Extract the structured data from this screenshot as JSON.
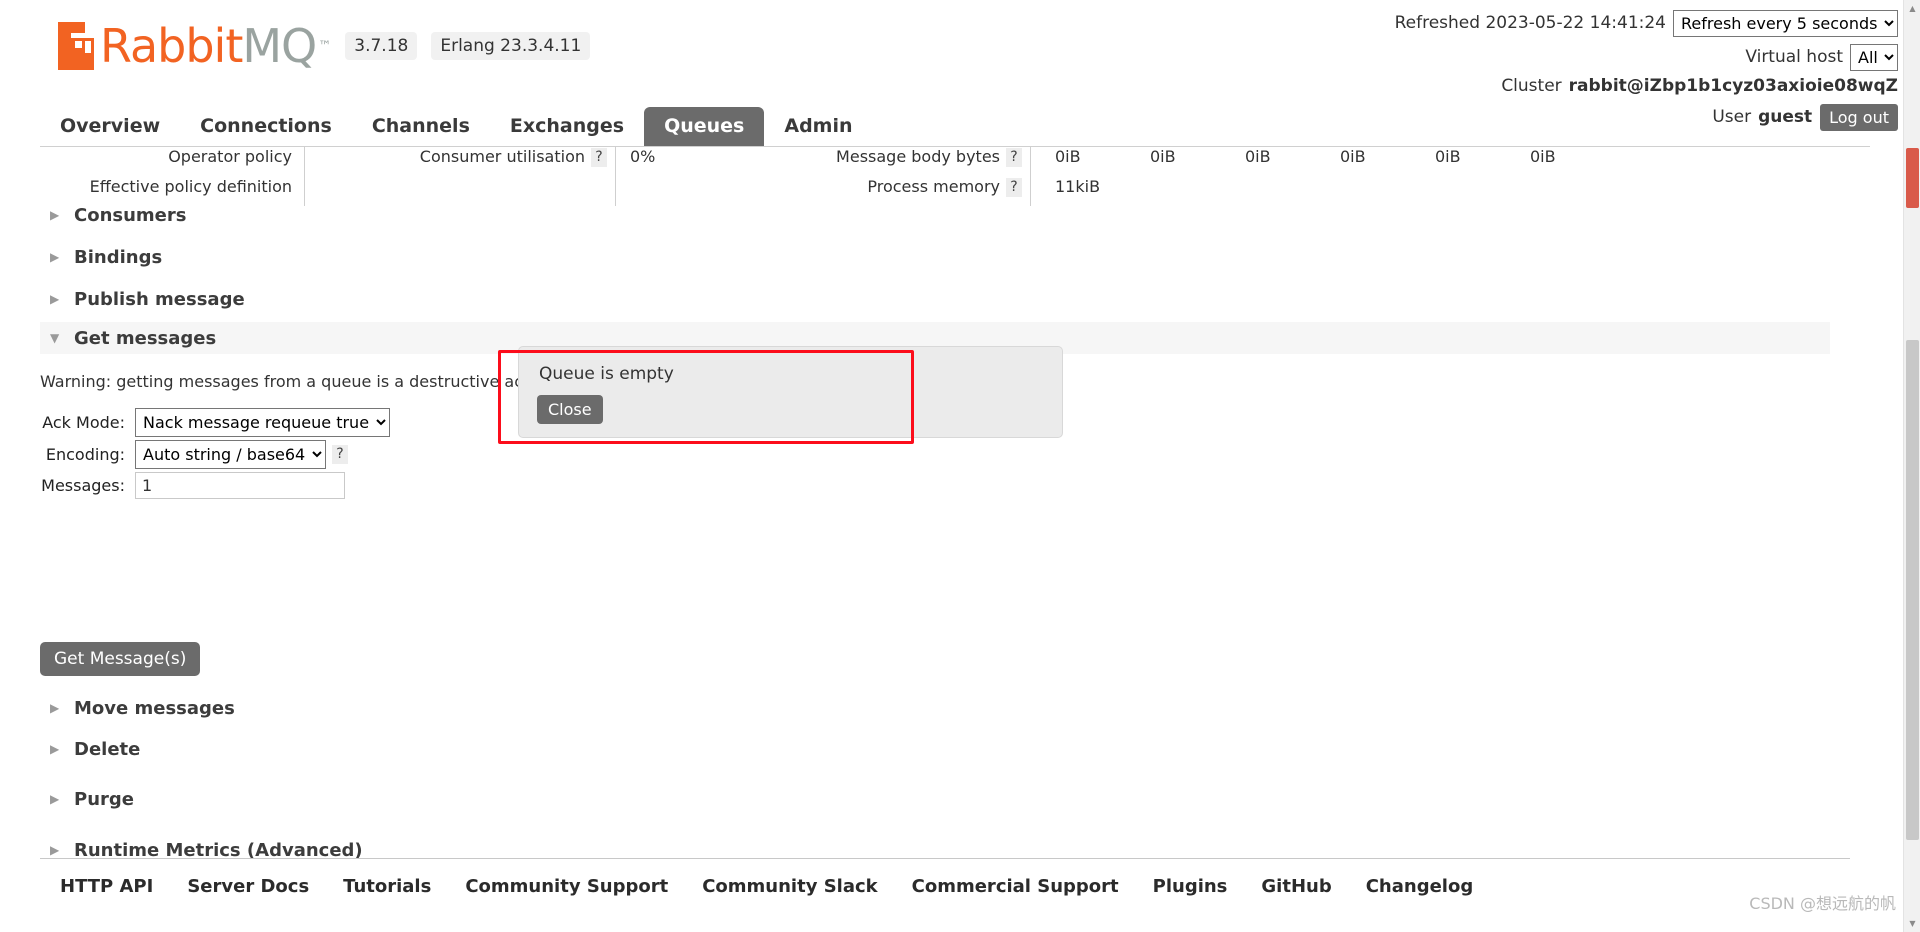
{
  "brand": {
    "name_rabbit": "Rabbit",
    "name_mq": "MQ",
    "tm": "™",
    "version": "3.7.18",
    "erlang": "Erlang 23.3.4.11",
    "accent_color": "#f26322",
    "mq_color": "#9aa3a0"
  },
  "header": {
    "refreshed_label": "Refreshed 2023-05-22 14:41:24",
    "refresh_select_value": "Refresh every 5 seconds",
    "refresh_options": [
      "Refresh every 5 seconds"
    ],
    "vhost_label": "Virtual host",
    "vhost_select_value": "All",
    "vhost_options": [
      "All"
    ],
    "cluster_label": "Cluster",
    "cluster_name": "rabbit@iZbp1b1cyz03axioie08wqZ",
    "user_label": "User",
    "user_name": "guest",
    "logout_label": "Log out"
  },
  "tabs": [
    {
      "label": "Overview",
      "active": false
    },
    {
      "label": "Connections",
      "active": false
    },
    {
      "label": "Channels",
      "active": false
    },
    {
      "label": "Exchanges",
      "active": false
    },
    {
      "label": "Queues",
      "active": true
    },
    {
      "label": "Admin",
      "active": false
    }
  ],
  "stats": {
    "row1": {
      "policy_label": "Operator policy",
      "policy_value": "",
      "consumer_util_label": "Consumer utilisation",
      "consumer_util_help": "?",
      "consumer_util_value": "0%",
      "body_bytes_label": "Message body bytes",
      "body_bytes_help": "?",
      "body_bytes_values": [
        "0iB",
        "0iB",
        "0iB",
        "0iB",
        "0iB",
        "0iB"
      ]
    },
    "row2": {
      "effective_policy_label": "Effective policy definition",
      "process_memory_label": "Process memory",
      "process_memory_help": "?",
      "process_memory_value": "11kiB"
    }
  },
  "popup": {
    "message": "Queue is empty",
    "close_label": "Close",
    "highlight_color": "#fc0d1b"
  },
  "sections": [
    {
      "label": "Consumers",
      "open": false,
      "arrow": "▶"
    },
    {
      "label": "Bindings",
      "open": false,
      "arrow": "▶"
    },
    {
      "label": "Publish message",
      "open": false,
      "arrow": "▶"
    },
    {
      "label": "Get messages",
      "open": true,
      "arrow": "▼"
    },
    {
      "label": "Move messages",
      "open": false,
      "arrow": "▶"
    },
    {
      "label": "Delete",
      "open": false,
      "arrow": "▶"
    },
    {
      "label": "Purge",
      "open": false,
      "arrow": "▶"
    },
    {
      "label": "Runtime Metrics (Advanced)",
      "open": false,
      "arrow": "▶"
    }
  ],
  "get_messages": {
    "warning_text": "Warning: getting messages from a queue is a destructive action.",
    "warning_help": "?",
    "ack_mode_label": "Ack Mode:",
    "ack_mode_value": "Nack message requeue true",
    "ack_mode_options": [
      "Nack message requeue true"
    ],
    "encoding_label": "Encoding:",
    "encoding_value": "Auto string / base64",
    "encoding_options": [
      "Auto string / base64"
    ],
    "encoding_help": "?",
    "messages_label": "Messages:",
    "messages_value": "1",
    "messages_placeholder": "",
    "submit_label": "Get Message(s)"
  },
  "footer": {
    "links": [
      "HTTP API",
      "Server Docs",
      "Tutorials",
      "Community Support",
      "Community Slack",
      "Commercial Support",
      "Plugins",
      "GitHub",
      "Changelog"
    ],
    "watermark": "CSDN @想远航的帆"
  }
}
